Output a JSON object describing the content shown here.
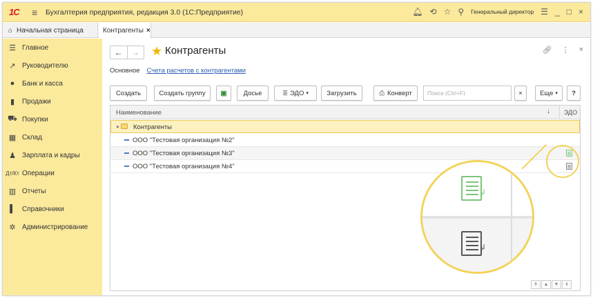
{
  "app": {
    "logo": "1С",
    "title": "Бухгалтерия предприятия, редакция 3.0  (1С:Предприятие)",
    "user": "Генеральный директор"
  },
  "tabs": {
    "home": "Начальная страница",
    "active": "Контрагенты",
    "close": "×"
  },
  "sidebar": {
    "items": [
      {
        "label": "Главное",
        "icon": "menu-lines-icon"
      },
      {
        "label": "Руководителю",
        "icon": "trend-icon"
      },
      {
        "label": "Банк и касса",
        "icon": "coin-icon"
      },
      {
        "label": "Продажи",
        "icon": "bag-icon"
      },
      {
        "label": "Покупки",
        "icon": "cart-icon"
      },
      {
        "label": "Склад",
        "icon": "warehouse-icon"
      },
      {
        "label": "Зарплата и кадры",
        "icon": "person-icon"
      },
      {
        "label": "Операции",
        "icon": "operations-icon"
      },
      {
        "label": "Отчеты",
        "icon": "bar-chart-icon"
      },
      {
        "label": "Справочники",
        "icon": "book-icon"
      },
      {
        "label": "Администрирование",
        "icon": "gear-icon"
      }
    ]
  },
  "form": {
    "title": "Контрагенты",
    "nav_back": "←",
    "nav_forward": "→",
    "link_main": "Основное",
    "link_accounts": "Счета расчетов с контрагентами"
  },
  "toolbar": {
    "create": "Создать",
    "create_group": "Создать группу",
    "dossier": "Досье",
    "edo": "ЭДО",
    "load": "Загрузить",
    "envelope": "Конверт",
    "search_placeholder": "Поиск (Ctrl+F)",
    "search_clear": "×",
    "more": "Еще",
    "help": "?"
  },
  "table": {
    "columns": {
      "name": "Наименование",
      "sort": "↓",
      "edo": "ЭДО"
    },
    "rows": [
      {
        "name": "Контрагенты",
        "type": "folder"
      },
      {
        "name": "ООО \"Тестовая организация №2\"",
        "type": "item"
      },
      {
        "name": "ООО \"Тестовая организация №3\"",
        "type": "item",
        "edo_status": "connected",
        "edo_color": "#7cc47c"
      },
      {
        "name": "ООО \"Тестовая организация №4\"",
        "type": "item",
        "edo_status": "not-connected",
        "edo_color": "#808080"
      }
    ]
  },
  "pager": [
    "⇞",
    "▲",
    "▼",
    "⇟"
  ],
  "colors": {
    "accent": "#fbe99c",
    "highlight": "#f2d35a",
    "link": "#2a5db0",
    "edo_connected": "#7cc47c",
    "edo_not_connected": "#808080"
  }
}
